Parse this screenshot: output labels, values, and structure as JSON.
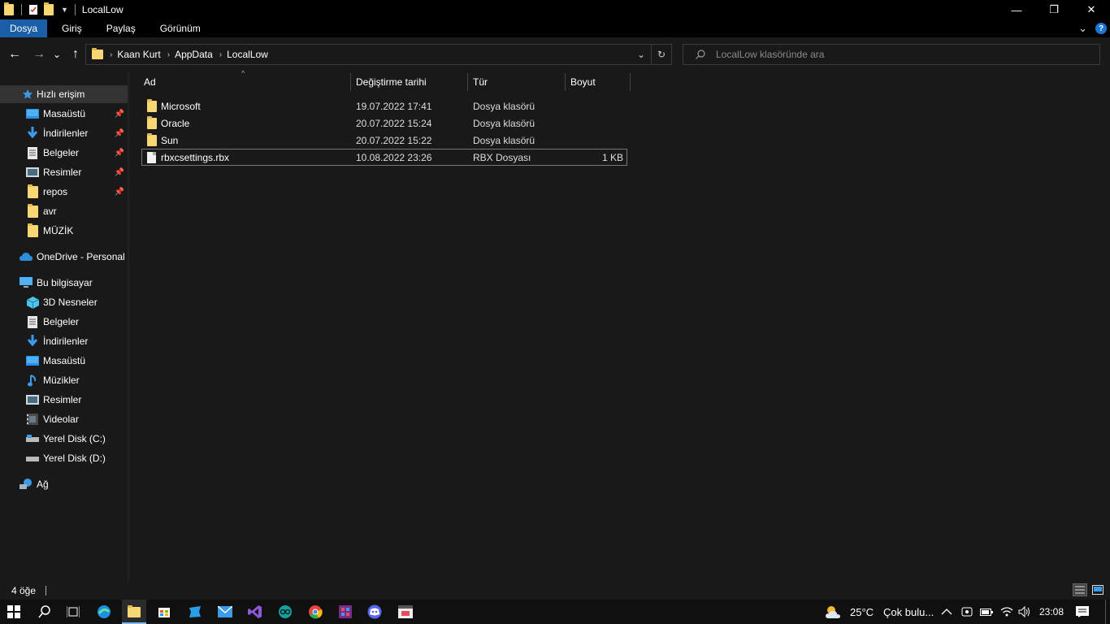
{
  "window": {
    "title": "LocalLow",
    "minimize_label": "—",
    "restore_label": "❐",
    "close_label": "✕"
  },
  "ribbon": {
    "tabs": [
      "Dosya",
      "Giriş",
      "Paylaş",
      "Görünüm"
    ],
    "active_tab": "Dosya",
    "expand_label": "⌄",
    "help_label": "?"
  },
  "nav": {
    "back_label": "←",
    "forward_label": "→",
    "recent_label": "⌄",
    "up_label": "↑",
    "breadcrumbs": [
      "Kaan Kurt",
      "AppData",
      "LocalLow"
    ],
    "dropdown_label": "⌄",
    "refresh_label": "↻",
    "search_placeholder": "LocalLow klasöründe ara"
  },
  "sidebar": {
    "quick_access": "Hızlı erişim",
    "quick_items": [
      {
        "label": "Masaüstü",
        "icon": "desktop-icon",
        "pinned": true
      },
      {
        "label": "İndirilenler",
        "icon": "download-icon",
        "pinned": true
      },
      {
        "label": "Belgeler",
        "icon": "documents-icon",
        "pinned": true
      },
      {
        "label": "Resimler",
        "icon": "pictures-icon",
        "pinned": true
      },
      {
        "label": "repos",
        "icon": "folder-icon",
        "pinned": true
      },
      {
        "label": "avr",
        "icon": "folder-icon",
        "pinned": false
      },
      {
        "label": "MÜZİK",
        "icon": "folder-icon",
        "pinned": false
      }
    ],
    "onedrive": "OneDrive - Personal",
    "this_pc": "Bu bilgisayar",
    "pc_items": [
      {
        "label": "3D Nesneler",
        "icon": "3d-objects-icon"
      },
      {
        "label": "Belgeler",
        "icon": "documents-icon"
      },
      {
        "label": "İndirilenler",
        "icon": "download-icon"
      },
      {
        "label": "Masaüstü",
        "icon": "desktop-icon"
      },
      {
        "label": "Müzikler",
        "icon": "music-icon"
      },
      {
        "label": "Resimler",
        "icon": "pictures-icon"
      },
      {
        "label": "Videolar",
        "icon": "videos-icon"
      },
      {
        "label": "Yerel Disk (C:)",
        "icon": "drive-icon"
      },
      {
        "label": "Yerel Disk (D:)",
        "icon": "drive-icon"
      }
    ],
    "network": "Ağ",
    "pin_glyph": "📌"
  },
  "columns": {
    "name": "Ad",
    "date": "Değiştirme tarihi",
    "type": "Tür",
    "size": "Boyut"
  },
  "files": [
    {
      "name": "Microsoft",
      "date": "19.07.2022 17:41",
      "type": "Dosya klasörü",
      "size": "",
      "kind": "folder"
    },
    {
      "name": "Oracle",
      "date": "20.07.2022 15:24",
      "type": "Dosya klasörü",
      "size": "",
      "kind": "folder"
    },
    {
      "name": "Sun",
      "date": "20.07.2022 15:22",
      "type": "Dosya klasörü",
      "size": "",
      "kind": "folder"
    },
    {
      "name": "rbxcsettings.rbx",
      "date": "10.08.2022 23:26",
      "type": "RBX Dosyası",
      "size": "1 KB",
      "kind": "file"
    }
  ],
  "status": {
    "count": "4 öğe"
  },
  "taskbar": {
    "temperature": "25°C",
    "weather": "Çok bulu...",
    "time": "23:08"
  },
  "colors": {
    "accent": "#1a5ea8",
    "folder": "#f8d775",
    "background": "#191919"
  }
}
